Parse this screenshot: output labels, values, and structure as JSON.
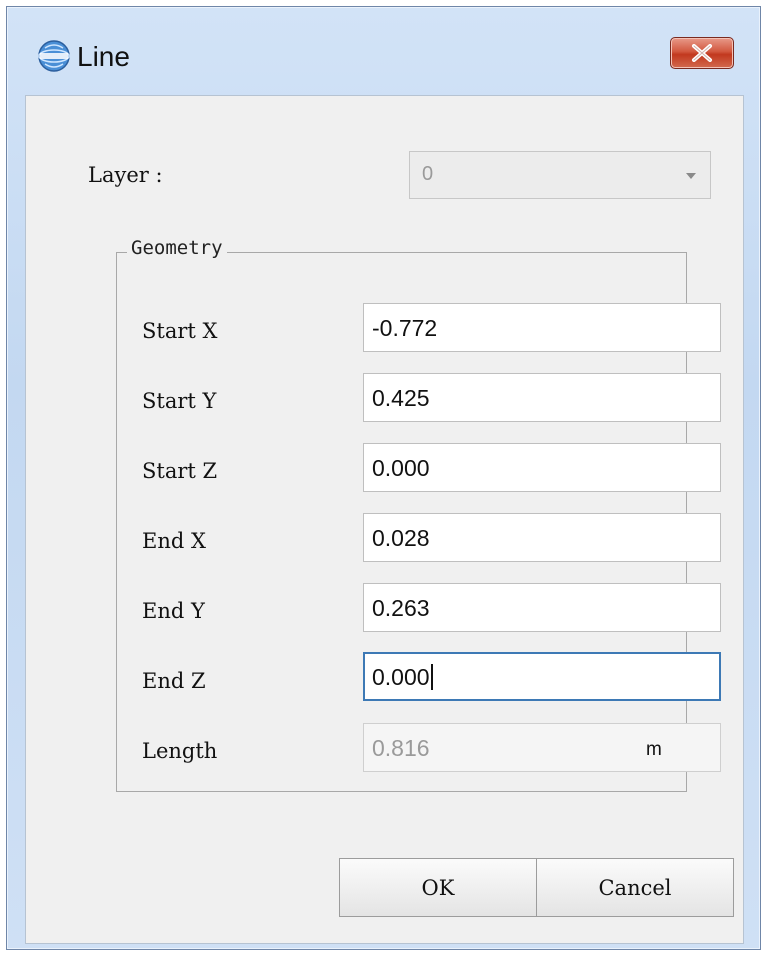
{
  "window": {
    "title": "Line",
    "app_icon": "app-globe-icon",
    "close_icon": "close-icon",
    "close_color": "#c8452a"
  },
  "layer": {
    "label": "Layer :",
    "value": "0"
  },
  "geometry": {
    "title": "Geometry",
    "fields": [
      {
        "label": "Start X",
        "value": "-0.772"
      },
      {
        "label": "Start Y",
        "value": "0.425"
      },
      {
        "label": "Start Z",
        "value": "0.000"
      },
      {
        "label": "End X",
        "value": "0.028"
      },
      {
        "label": "End Y",
        "value": "0.263"
      },
      {
        "label": "End Z",
        "value": "0.000"
      },
      {
        "label": "Length",
        "value": "0.816"
      }
    ],
    "length_unit": "m"
  },
  "buttons": {
    "ok": "OK",
    "cancel": "Cancel"
  }
}
